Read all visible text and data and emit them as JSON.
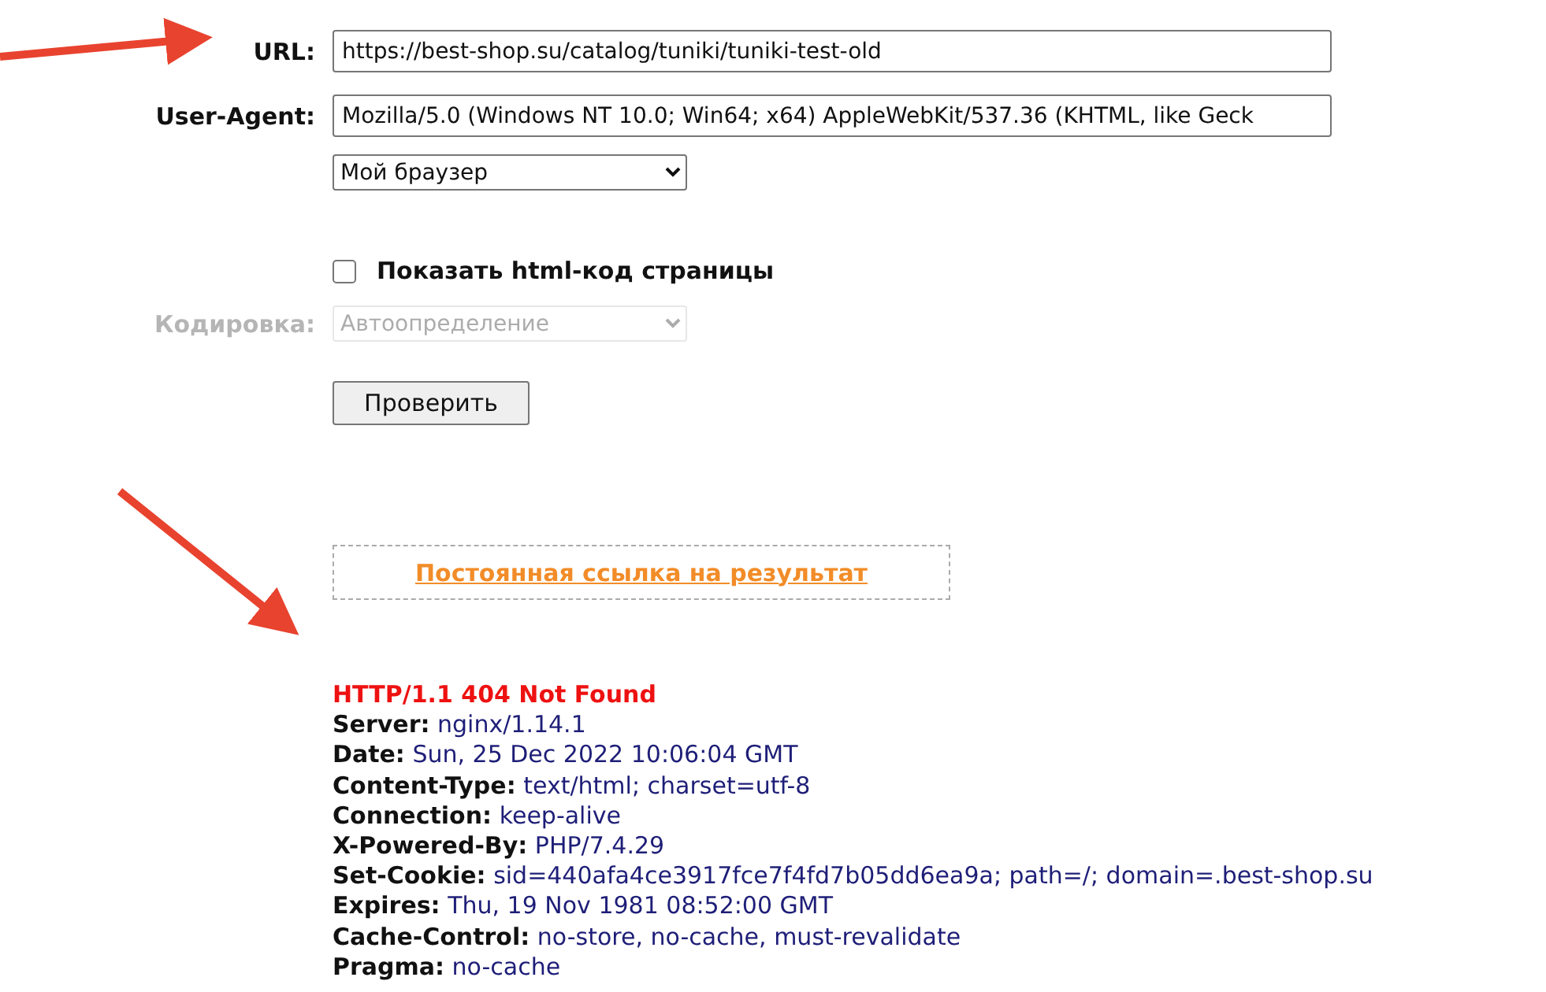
{
  "form": {
    "url": {
      "label": "URL:",
      "value": "https://best-shop.su/catalog/tuniki/tuniki-test-old"
    },
    "user_agent": {
      "label": "User-Agent:",
      "value": "Mozilla/5.0 (Windows NT 10.0; Win64; x64) AppleWebKit/537.36 (KHTML, like Geck"
    },
    "browser_select": {
      "value": "Мой браузер",
      "disabled": false
    },
    "show_html": {
      "label": "Показать html-код страницы",
      "checked": false
    },
    "encoding": {
      "label": "Кодировка:",
      "value": "Автоопределение",
      "disabled": true
    },
    "submit": "Проверить"
  },
  "permalink": "Постоянная ссылка на результат",
  "response": {
    "status": "HTTP/1.1 404 Not Found",
    "headers": [
      {
        "name": "Server:",
        "value": "nginx/1.14.1"
      },
      {
        "name": "Date:",
        "value": "Sun, 25 Dec 2022 10:06:04 GMT"
      },
      {
        "name": "Content-Type:",
        "value": "text/html; charset=utf-8"
      },
      {
        "name": "Connection:",
        "value": "keep-alive"
      },
      {
        "name": "X-Powered-By:",
        "value": "PHP/7.4.29"
      },
      {
        "name": "Set-Cookie:",
        "value": "sid=440afa4ce3917fce7f4fd7b05dd6ea9a; path=/; domain=.best-shop.su"
      },
      {
        "name": "Expires:",
        "value": "Thu, 19 Nov 1981 08:52:00 GMT"
      },
      {
        "name": "Cache-Control:",
        "value": "no-store, no-cache, must-revalidate"
      },
      {
        "name": "Pragma:",
        "value": "no-cache"
      }
    ]
  }
}
